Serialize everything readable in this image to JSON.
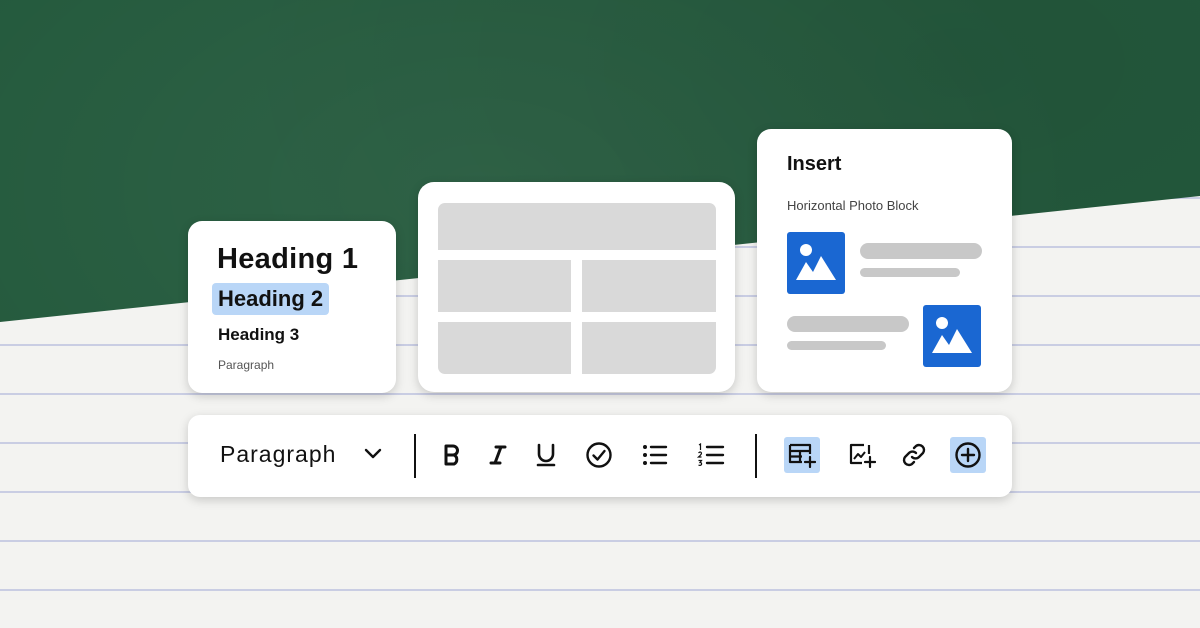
{
  "colors": {
    "background_green": "#245a3d",
    "paper": "#f3f3f1",
    "highlight": "#b9d6f7",
    "photo_blue": "#1a67d2",
    "placeholder_gray": "#d9d9d9"
  },
  "heading_card": {
    "heading1": "Heading 1",
    "heading2": "Heading 2",
    "heading3": "Heading 3",
    "paragraph": "Paragraph",
    "selected": "Heading 2"
  },
  "layout_card": {
    "icon": "table-layout-placeholder"
  },
  "insert_card": {
    "title": "Insert",
    "subtitle": "Horizontal Photo Block",
    "icons": [
      "image-icon",
      "image-icon"
    ]
  },
  "toolbar": {
    "style_select": "Paragraph",
    "buttons": [
      {
        "name": "bold-icon",
        "active": false
      },
      {
        "name": "italic-icon",
        "active": false
      },
      {
        "name": "underline-icon",
        "active": false
      },
      {
        "name": "checkmark-circle-icon",
        "active": false
      },
      {
        "name": "bullet-list-icon",
        "active": false
      },
      {
        "name": "numbered-list-icon",
        "active": false
      },
      {
        "name": "insert-table-icon",
        "active": true
      },
      {
        "name": "insert-image-icon",
        "active": false
      },
      {
        "name": "link-icon",
        "active": false
      },
      {
        "name": "add-circle-icon",
        "active": true
      }
    ]
  }
}
